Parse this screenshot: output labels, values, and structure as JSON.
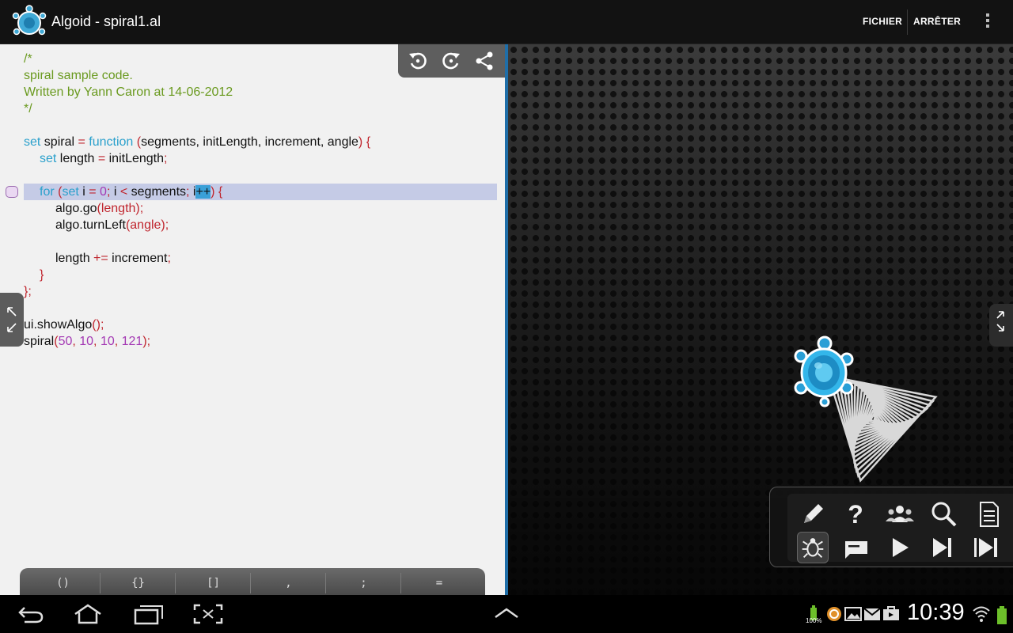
{
  "app": {
    "title": "Algoid - spiral1.al",
    "actions": {
      "file": "FICHIER",
      "stop": "ARRÊTER"
    },
    "icons": {
      "logo": "turtle-logo-icon",
      "overflow": "overflow-menu-icon"
    }
  },
  "editor": {
    "toolbar_icons": [
      "undo-icon",
      "redo-icon",
      "share-icon"
    ],
    "code": {
      "l1": "/*",
      "l2": "spiral sample code.",
      "l3": "Written by Yann Caron at 14-06-2012",
      "l4": "*/",
      "l6_set": "set",
      "l6_name": " spiral ",
      "l6_eq": "=",
      "l6_fn": "function",
      "l6_open": "(",
      "l6_params": "segments, initLength, increment, angle",
      "l6_close": ") {",
      "l7_set": "set",
      "l7_rest": " length ",
      "l7_eq": "=",
      "l7_val": " initLength",
      "l7_semi": ";",
      "l9_for": "for",
      "l9_p": " (",
      "l9_set": "set",
      "l9_i": " i ",
      "l9_eq": "=",
      "l9_zero": "0",
      "l9_semi1": ";",
      "l9_i2": " i ",
      "l9_lt": "<",
      "l9_seg": " segments",
      "l9_semi2": ";",
      "l9_i3": " i",
      "l9_inc": "++",
      "l9_end": ") {",
      "l10": "algo.go",
      "l10_args": "(length);",
      "l11": "algo.turnLeft",
      "l11_args": "(angle);",
      "l13": "length ",
      "l13_op": "+=",
      "l13_val": " increment",
      "l13_semi": ";",
      "l14": "}",
      "l15": "};",
      "l17": "ui.showAlgo",
      "l17_args": "();",
      "l18": "spiral",
      "l18_open": "(",
      "l18_a": "50",
      "l18_c1": ", ",
      "l18_b": "10",
      "l18_c2": ", ",
      "l18_c": "10",
      "l18_c3": ", ",
      "l18_d": "121",
      "l18_close": ");"
    },
    "keys": [
      "()",
      "{}",
      "[]",
      ",",
      ";",
      "="
    ]
  },
  "canvas": {
    "palette_top": [
      "pencil-icon",
      "help-icon",
      "community-icon",
      "search-icon",
      "document-icon"
    ],
    "palette_bottom": [
      "debug-bug-icon",
      "console-icon",
      "play-icon",
      "step-icon",
      "step-end-icon"
    ]
  },
  "system": {
    "clock": "10:39",
    "battery": "100%",
    "nav_icons": [
      "back-icon",
      "home-icon",
      "recent-apps-icon",
      "screenshot-icon",
      "up-chevron-icon"
    ]
  }
}
